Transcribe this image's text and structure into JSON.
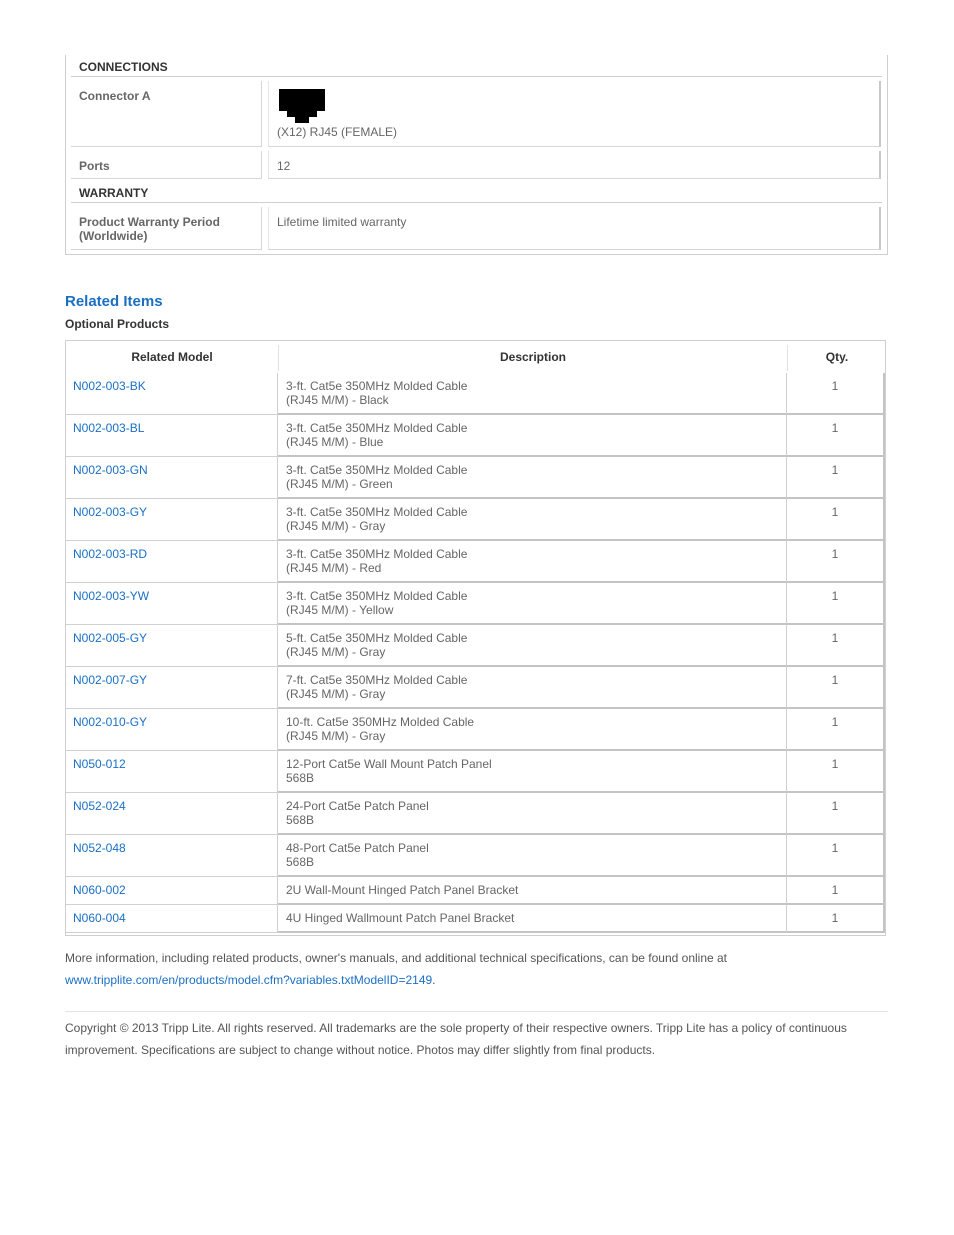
{
  "specs": {
    "connections_heading": "CONNECTIONS",
    "connector_a_label": "Connector A",
    "connector_a_icon": "rj45-female-icon",
    "connector_a_value": "(X12) RJ45 (FEMALE)",
    "ports_label": "Ports",
    "ports_value": "12",
    "warranty_heading": "WARRANTY",
    "warranty_label_line1": "Product Warranty Period",
    "warranty_label_line2": "(Worldwide)",
    "warranty_value": "Lifetime limited warranty"
  },
  "related": {
    "title": "Related Items",
    "subtitle": "Optional Products",
    "columns": [
      "Related Model",
      "Description",
      "Qty."
    ],
    "rows": [
      {
        "model": "N002-003-BK",
        "desc1": "3-ft. Cat5e 350MHz Molded Cable",
        "desc2": "(RJ45 M/M) - Black",
        "qty": "1"
      },
      {
        "model": "N002-003-BL",
        "desc1": "3-ft. Cat5e 350MHz Molded Cable",
        "desc2": "(RJ45 M/M) - Blue",
        "qty": "1"
      },
      {
        "model": "N002-003-GN",
        "desc1": "3-ft. Cat5e 350MHz Molded Cable",
        "desc2": "(RJ45 M/M) - Green",
        "qty": "1"
      },
      {
        "model": "N002-003-GY",
        "desc1": "3-ft. Cat5e 350MHz Molded Cable",
        "desc2": "(RJ45 M/M) - Gray",
        "qty": "1"
      },
      {
        "model": "N002-003-RD",
        "desc1": "3-ft. Cat5e 350MHz Molded Cable",
        "desc2": "(RJ45 M/M) - Red",
        "qty": "1"
      },
      {
        "model": "N002-003-YW",
        "desc1": "3-ft. Cat5e 350MHz Molded Cable",
        "desc2": "(RJ45 M/M) - Yellow",
        "qty": "1"
      },
      {
        "model": "N002-005-GY",
        "desc1": "5-ft. Cat5e 350MHz Molded Cable",
        "desc2": "(RJ45 M/M) - Gray",
        "qty": "1"
      },
      {
        "model": "N002-007-GY",
        "desc1": "7-ft. Cat5e 350MHz Molded Cable",
        "desc2": "(RJ45 M/M) - Gray",
        "qty": "1"
      },
      {
        "model": "N002-010-GY",
        "desc1": "10-ft. Cat5e 350MHz Molded Cable",
        "desc2": "(RJ45 M/M) - Gray",
        "qty": "1"
      },
      {
        "model": "N050-012",
        "desc1": "12-Port Cat5e Wall Mount Patch Panel",
        "desc2": "568B",
        "qty": "1"
      },
      {
        "model": "N052-024",
        "desc1": "24-Port Cat5e Patch Panel",
        "desc2": "568B",
        "qty": "1"
      },
      {
        "model": "N052-048",
        "desc1": "48-Port Cat5e Patch Panel",
        "desc2": "568B",
        "qty": "1"
      },
      {
        "model": "N060-002",
        "desc1": "2U Wall-Mount Hinged Patch Panel Bracket",
        "desc2": "",
        "qty": "1"
      },
      {
        "model": "N060-004",
        "desc1": "4U Hinged Wallmount Patch Panel Bracket",
        "desc2": "",
        "qty": "1"
      }
    ]
  },
  "footer": {
    "more_info_text": "More information, including related products, owner's manuals, and additional technical specifications, can be found online at",
    "more_info_link": "www.tripplite.com/en/products/model.cfm?variables.txtModelID=2149",
    "more_info_suffix": ".",
    "copyright": "Copyright © 2013 Tripp Lite. All rights reserved. All trademarks are the sole property of their respective owners. Tripp Lite has a policy of continuous improvement. Specifications are subject to change without notice. Photos may differ slightly from final products."
  },
  "colors": {
    "link": "#1a6fc4",
    "heading": "#333333",
    "text": "#555555",
    "border": "#cfcfcf"
  }
}
